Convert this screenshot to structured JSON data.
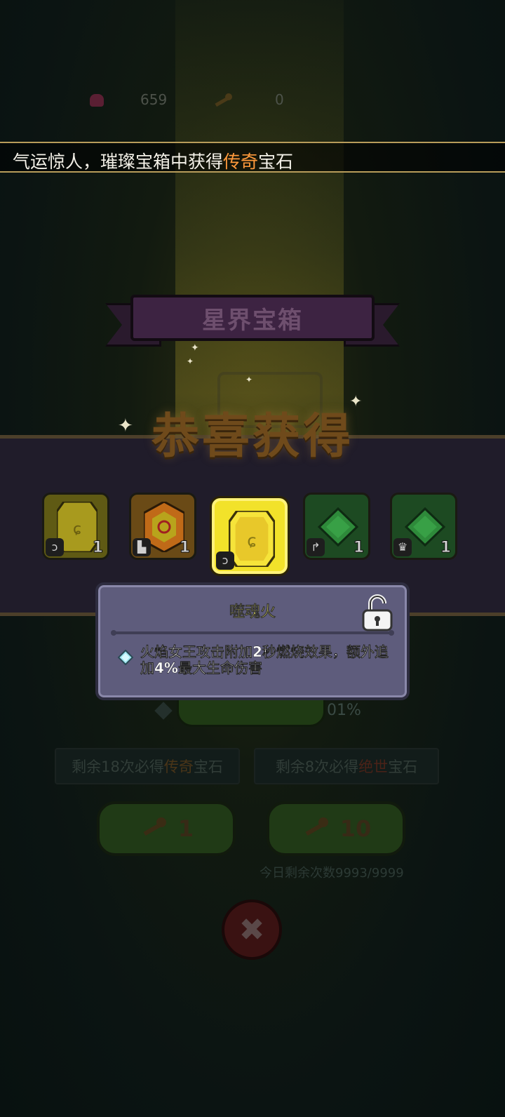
{
  "resources": {
    "gem_count": "659",
    "key_count": "0"
  },
  "banner": {
    "prefix": "气运惊人，璀璨宝箱中获得",
    "highlight": "传奇",
    "suffix": "宝石"
  },
  "chest": {
    "title": "星界宝箱"
  },
  "congrats": "恭喜获得",
  "rewards": [
    {
      "count": "1",
      "color": "#d2c42a",
      "tag_icon": "bow-icon"
    },
    {
      "count": "1",
      "color": "#e48a20",
      "tag_icon": "boot-icon"
    },
    {
      "count": "",
      "color": "#f0d820",
      "tag_icon": "bow-icon",
      "selected": true
    },
    {
      "count": "1",
      "color": "#2ea83c",
      "tag_icon": "axe-icon"
    },
    {
      "count": "1",
      "color": "#2ea83c",
      "tag_icon": "crown-icon"
    }
  ],
  "tooltip": {
    "title": "噬魂火",
    "description": "火焰女王攻击附加2秒燃烧效果，额外追加4%最大生命伤害"
  },
  "dim": {
    "percent": "01%",
    "pity_left_prefix": "剩余18次必得",
    "pity_left_hl": "传奇",
    "pity_left_suffix": "宝石",
    "pity_right_prefix": "剩余8次必得",
    "pity_right_hl": "绝世",
    "pity_right_suffix": "宝石",
    "draw_one": "1",
    "draw_ten": "10",
    "quota": "今日剩余次数9993/9999"
  },
  "colors": {
    "accent_orange": "#ff9a3c",
    "tooltip_title": "#fff76a",
    "tooltip_bg": "#5e5c7c"
  }
}
